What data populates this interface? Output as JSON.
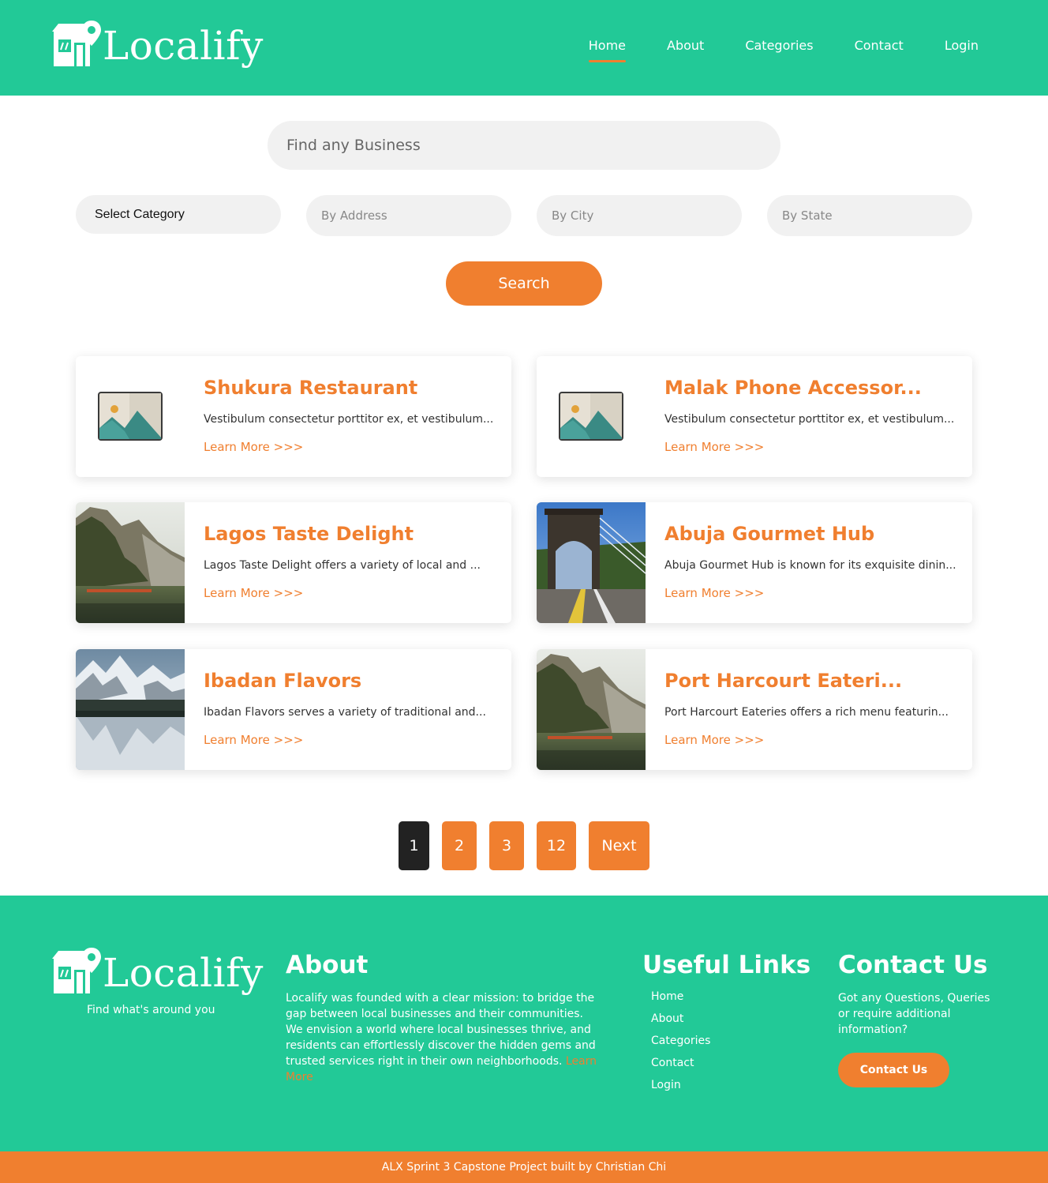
{
  "brand": {
    "name": "Localify",
    "tagline": "Find what's around you"
  },
  "nav": {
    "items": [
      {
        "label": "Home",
        "active": true
      },
      {
        "label": "About"
      },
      {
        "label": "Categories"
      },
      {
        "label": "Contact"
      },
      {
        "label": "Login"
      }
    ]
  },
  "search": {
    "placeholder": "Find any Business",
    "category_select": "Select Category",
    "address_placeholder": "By Address",
    "city_placeholder": "By City",
    "state_placeholder": "By State",
    "button_label": "Search"
  },
  "listings": [
    {
      "title": "Shukura Restaurant",
      "desc": "Vestibulum consectetur porttitor ex, et vestibulum...",
      "link": "Learn More >>>",
      "image": "placeholder-image-icon"
    },
    {
      "title": "Malak Phone Accessor...",
      "desc": "Vestibulum consectetur porttitor ex, et vestibulum...",
      "link": "Learn More >>>",
      "image": "placeholder-image-icon"
    },
    {
      "title": "Lagos Taste Delight",
      "desc": "Lagos Taste Delight offers a variety of local and ...",
      "link": "Learn More >>>",
      "image": "mountain-lake-photo"
    },
    {
      "title": "Abuja Gourmet Hub",
      "desc": "Abuja Gourmet Hub is known for its exquisite dinin...",
      "link": "Learn More >>>",
      "image": "bridge-photo"
    },
    {
      "title": "Ibadan Flavors",
      "desc": "Ibadan Flavors serves a variety of traditional and...",
      "link": "Learn More >>>",
      "image": "snowy-mountain-lake-photo"
    },
    {
      "title": "Port Harcourt Eateri...",
      "desc": "Port Harcourt Eateries offers a rich menu featurin...",
      "link": "Learn More >>>",
      "image": "mountain-lake-photo"
    }
  ],
  "pagination": {
    "pages": [
      "1",
      "2",
      "3",
      "12"
    ],
    "current": "1",
    "next_label": "Next"
  },
  "footer": {
    "about_heading": "About",
    "about_text": "Localify was founded with a clear mission: to bridge the gap between local businesses and their communities. We envision a world where local businesses thrive, and residents can effortlessly discover the hidden gems and trusted services right in their own neighborhoods.",
    "about_more": "Learn More",
    "links_heading": "Useful Links",
    "links": [
      "Home",
      "About",
      "Categories",
      "Contact",
      "Login"
    ],
    "contact_heading": "Contact Us",
    "contact_text": "Got any Questions, Queries or require additional information?",
    "contact_button": "Contact Us"
  },
  "credits": "ALX Sprint 3 Capstone Project built by Christian Chi",
  "colors": {
    "primary": "#22c997",
    "accent": "#f07f2f",
    "dark": "#222222",
    "input_bg": "#f1f1f1"
  }
}
